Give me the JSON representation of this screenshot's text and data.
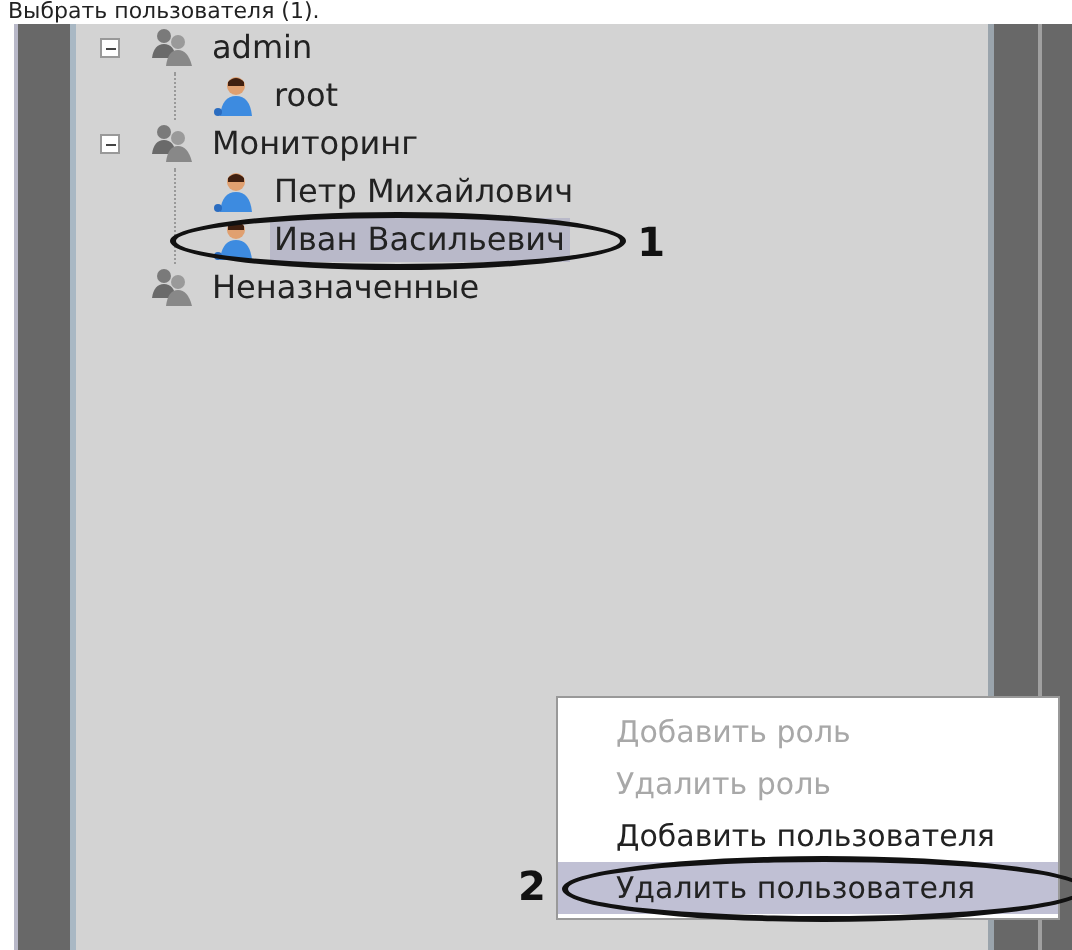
{
  "caption": "Выбрать пользователя (1).",
  "tree": [
    {
      "label": "admin",
      "kind": "group",
      "expanded": true,
      "selected": false,
      "children": [
        {
          "label": "root",
          "kind": "user",
          "selected": false
        }
      ]
    },
    {
      "label": "Мониторинг",
      "kind": "group",
      "expanded": true,
      "selected": false,
      "children": [
        {
          "label": "Петр Михайлович",
          "kind": "user",
          "selected": false
        },
        {
          "label": "Иван Васильевич",
          "kind": "user",
          "selected": true,
          "callout": "1"
        }
      ]
    },
    {
      "label": "Неназначенные",
      "kind": "group",
      "selected": false
    }
  ],
  "context_menu": {
    "items": [
      {
        "label": "Добавить роль",
        "disabled": true,
        "selected": false
      },
      {
        "label": "Удалить роль",
        "disabled": true,
        "selected": false
      },
      {
        "label": "Добавить пользователя",
        "disabled": false,
        "selected": false
      },
      {
        "label": "Удалить пользователя",
        "disabled": false,
        "selected": true,
        "callout": "2"
      }
    ]
  }
}
